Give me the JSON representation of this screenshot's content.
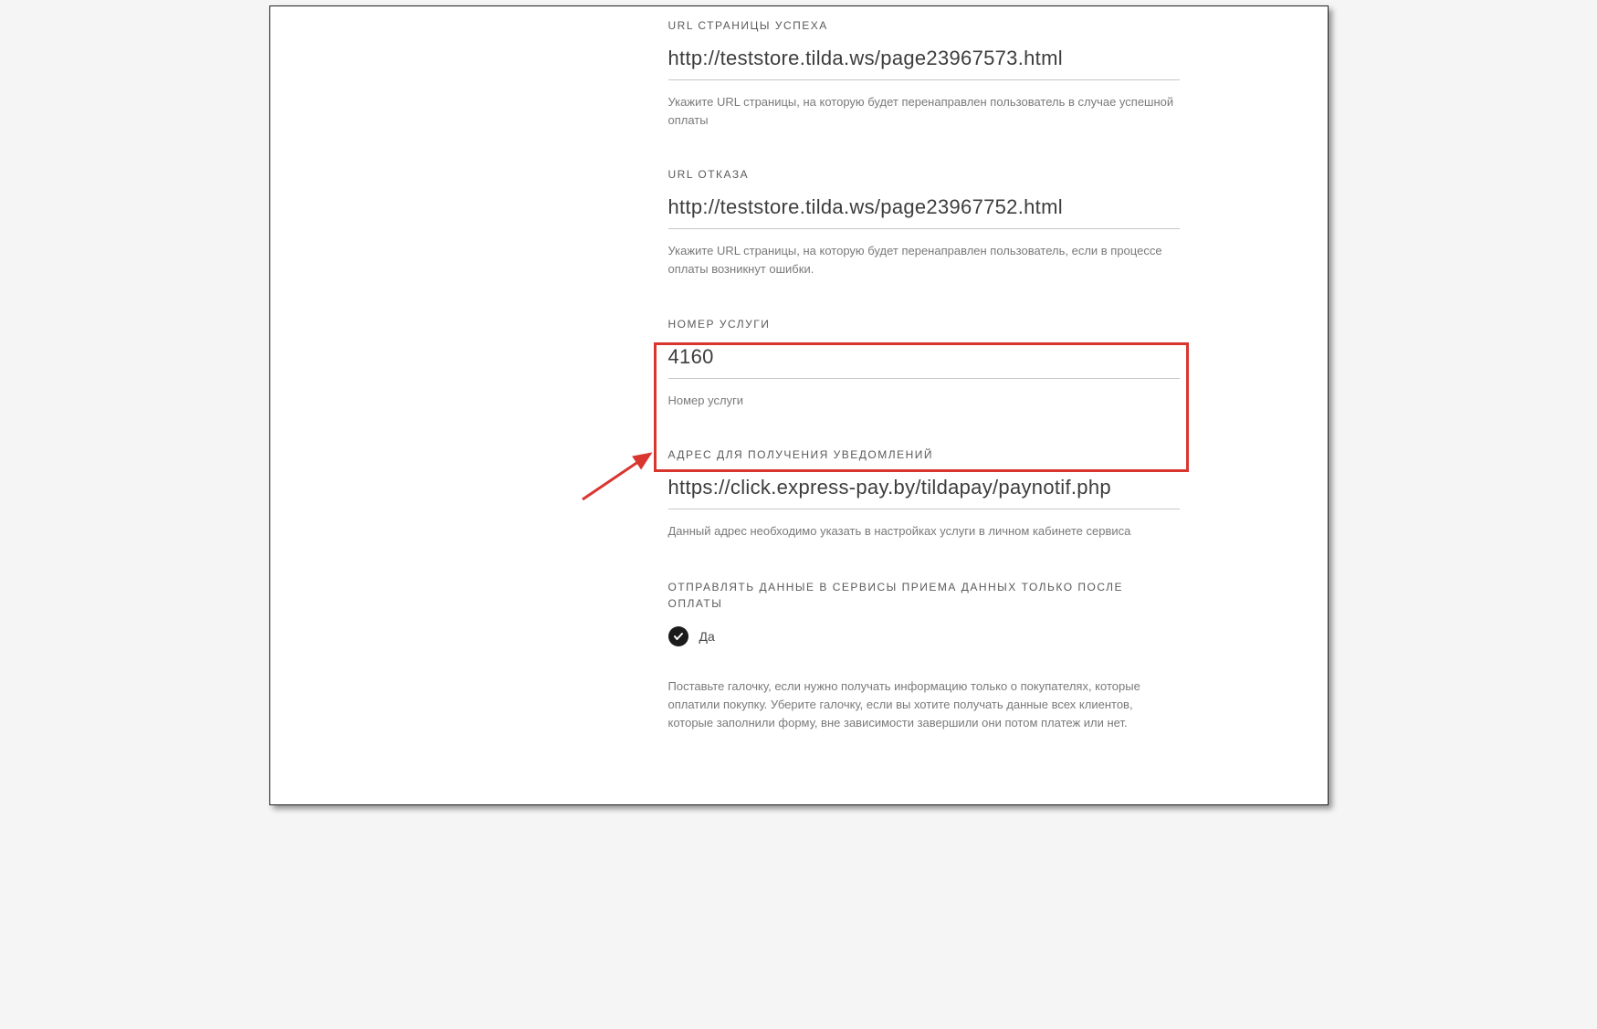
{
  "fields": {
    "success_url": {
      "label": "URL СТРАНИЦЫ УСПЕХА",
      "value": "http://teststore.tilda.ws/page23967573.html",
      "help": "Укажите URL страницы, на которую будет перенаправлен пользователь в случае успешной оплаты"
    },
    "cancel_url": {
      "label": "URL ОТКАЗА",
      "value": "http://teststore.tilda.ws/page23967752.html",
      "help": "Укажите URL страницы, на которую будет перенаправлен пользователь, если в процессе оплаты возникнут ошибки."
    },
    "service_number": {
      "label": "НОМЕР УСЛУГИ",
      "value": "4160",
      "help": "Номер услуги"
    },
    "notify_url": {
      "label": "АДРЕС ДЛЯ ПОЛУЧЕНИЯ УВЕДОМЛЕНИЙ",
      "value": "https://click.express-pay.by/tildapay/paynotif.php",
      "help": "Данный адрес необходимо указать в настройках услуги в личном кабинете сервиса"
    },
    "send_after_pay": {
      "label": "ОТПРАВЛЯТЬ ДАННЫЕ В СЕРВИСЫ ПРИЕМА ДАННЫХ ТОЛЬКО ПОСЛЕ ОПЛАТЫ",
      "option": "Да",
      "help": "Поставьте галочку, если нужно получать информацию только о покупателях, которые оплатили покупку. Уберите галочку, если вы хотите получать данные всех клиентов, которые заполнили форму, вне зависимости завершили они потом платеж или нет."
    }
  }
}
